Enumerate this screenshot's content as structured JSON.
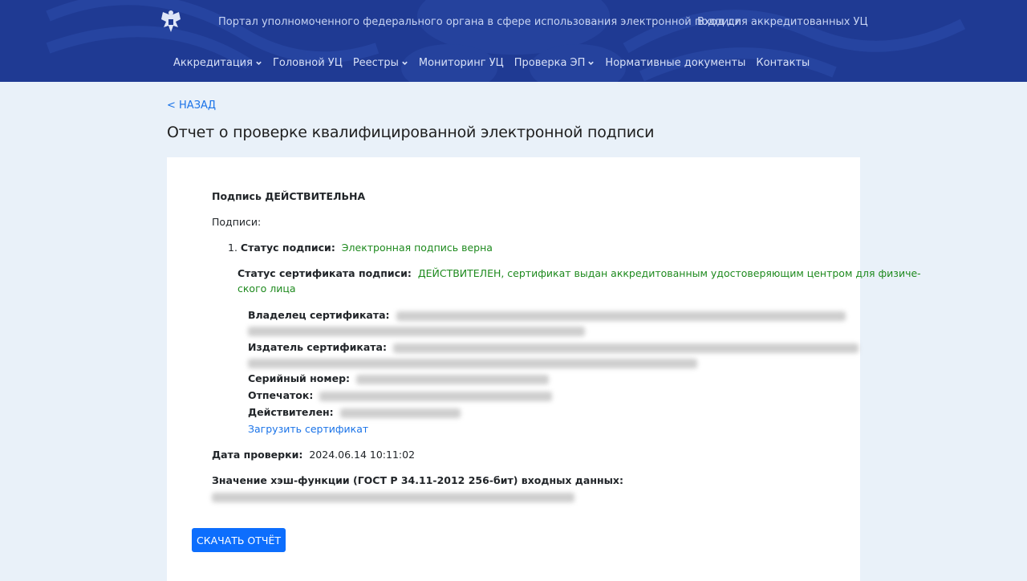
{
  "header": {
    "portal_title": "Портал уполномоченного федерального органа в сфере использования электронной подписи",
    "login_link": "Вход для аккредитованных УЦ",
    "nav": [
      {
        "label": "Аккредитация",
        "has_dropdown": true
      },
      {
        "label": "Головной УЦ",
        "has_dropdown": false
      },
      {
        "label": "Реестры",
        "has_dropdown": true
      },
      {
        "label": "Мониторинг УЦ",
        "has_dropdown": false
      },
      {
        "label": "Проверка ЭП",
        "has_dropdown": true
      },
      {
        "label": "Нормативные документы",
        "has_dropdown": false
      },
      {
        "label": "Контакты",
        "has_dropdown": false
      }
    ]
  },
  "page": {
    "back_link": "< НАЗАД",
    "title": "Отчет о проверке квалифицированной электронной подписи"
  },
  "report": {
    "result": "Подпись ДЕЙСТВИТЕЛЬНА",
    "signatures_label": "Подписи:",
    "signatures": [
      {
        "number": "1.",
        "status_label": "Статус подписи:",
        "status_value": "Электронная подпись верна",
        "cert_status_label": "Статус сертификата подписи:",
        "cert_status_value_line1": "ДЕЙСТВИТЕЛЕН, сертификат выдан аккредитованным удостоверяющим центром для физиче-",
        "cert_status_value_line2": "ского лица",
        "owner_label": "Владелец сертификата:",
        "issuer_label": "Издатель сертификата:",
        "serial_label": "Серийный номер:",
        "thumbprint_label": "Отпечаток:",
        "valid_label": "Действителен:",
        "download_cert": "Загрузить сертификат"
      }
    ],
    "check_date_label": "Дата проверки:",
    "check_date_value": "2024.06.14 10:11:02",
    "hash_label": "Значение хэш-функции (ГОСТ Р 34.11-2012 256-бит) входных данных:",
    "download_report": "СКАЧАТЬ ОТЧЁТ"
  },
  "colors": {
    "header_bg": "#1f3a93",
    "page_bg": "#e9f1f9",
    "status_green": "#1e8a1e",
    "link_blue": "#1a73e8",
    "button_blue": "#0d6efd"
  },
  "icons": [
    "emblem-icon",
    "chevron-down-icon"
  ]
}
